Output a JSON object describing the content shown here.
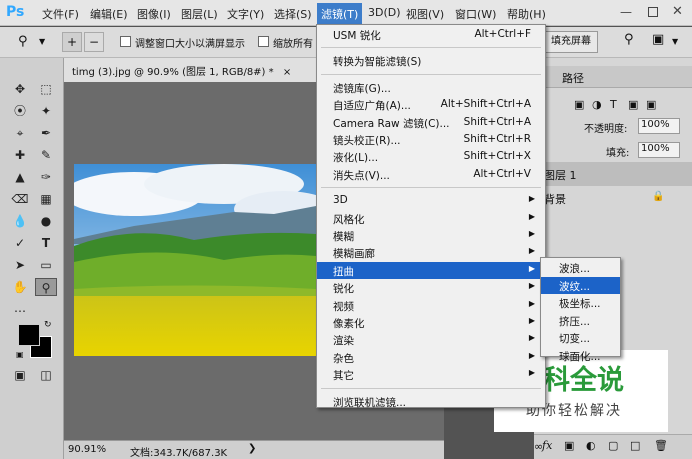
{
  "app": {
    "logo": "Ps"
  },
  "menubar": {
    "items": [
      "文件(F)",
      "编辑(E)",
      "图像(I)",
      "图层(L)",
      "文字(Y)",
      "选择(S)",
      "滤镜(T)",
      "3D(D)",
      "视图(V)",
      "窗口(W)",
      "帮助(H)"
    ],
    "active_index": 6
  },
  "options": {
    "resize_windows_label": "调整窗口大小以满屏显示",
    "zoom_all_label": "缩放所有",
    "fill_screen_label": "填充屏幕"
  },
  "document": {
    "tab_title": "timg (3).jpg @ 90.9% (图层 1, RGB/8#) *",
    "close_glyph": "×",
    "zoom": "90.91%",
    "doc_size": "文档:343.7K/687.3K"
  },
  "filter_menu": {
    "items": [
      {
        "label": "USM 锐化",
        "shortcut": "Alt+Ctrl+F"
      },
      {
        "sep": true
      },
      {
        "label": "转换为智能滤镜(S)"
      },
      {
        "sep": true
      },
      {
        "label": "滤镜库(G)..."
      },
      {
        "label": "自适应广角(A)...",
        "shortcut": "Alt+Shift+Ctrl+A"
      },
      {
        "label": "Camera Raw 滤镜(C)...",
        "shortcut": "Shift+Ctrl+A"
      },
      {
        "label": "镜头校正(R)...",
        "shortcut": "Shift+Ctrl+R"
      },
      {
        "label": "液化(L)...",
        "shortcut": "Shift+Ctrl+X"
      },
      {
        "label": "消失点(V)...",
        "shortcut": "Alt+Ctrl+V"
      },
      {
        "sep": true
      },
      {
        "label": "3D",
        "submenu": true
      },
      {
        "label": "风格化",
        "submenu": true
      },
      {
        "label": "模糊",
        "submenu": true
      },
      {
        "label": "模糊画廊",
        "submenu": true
      },
      {
        "label": "扭曲",
        "submenu": true,
        "highlighted": true
      },
      {
        "label": "锐化",
        "submenu": true
      },
      {
        "label": "视频",
        "submenu": true
      },
      {
        "label": "像素化",
        "submenu": true
      },
      {
        "label": "渲染",
        "submenu": true
      },
      {
        "label": "杂色",
        "submenu": true
      },
      {
        "label": "其它",
        "submenu": true
      },
      {
        "sep": true
      },
      {
        "label": "浏览联机滤镜..."
      }
    ]
  },
  "distort_submenu": {
    "items": [
      {
        "label": "波浪..."
      },
      {
        "label": "波纹...",
        "highlighted": true
      },
      {
        "label": "极坐标..."
      },
      {
        "label": "挤压..."
      },
      {
        "label": "切变..."
      },
      {
        "label": "球面化..."
      }
    ]
  },
  "layers_panel": {
    "tab_paths": "路径",
    "opacity_label": "不透明度:",
    "opacity_value": "100%",
    "fill_label": "填充:",
    "fill_value": "100%",
    "layers": [
      {
        "name": "图层 1",
        "locked": false
      },
      {
        "name": "背景",
        "locked": true
      }
    ]
  },
  "watermark": {
    "title": "百科全说",
    "subtitle": "助你轻松解决"
  },
  "colors": {
    "menu_highlight": "#1c63c8",
    "accent": "#3d7dca",
    "watermark_green": "#2a9a3a"
  }
}
